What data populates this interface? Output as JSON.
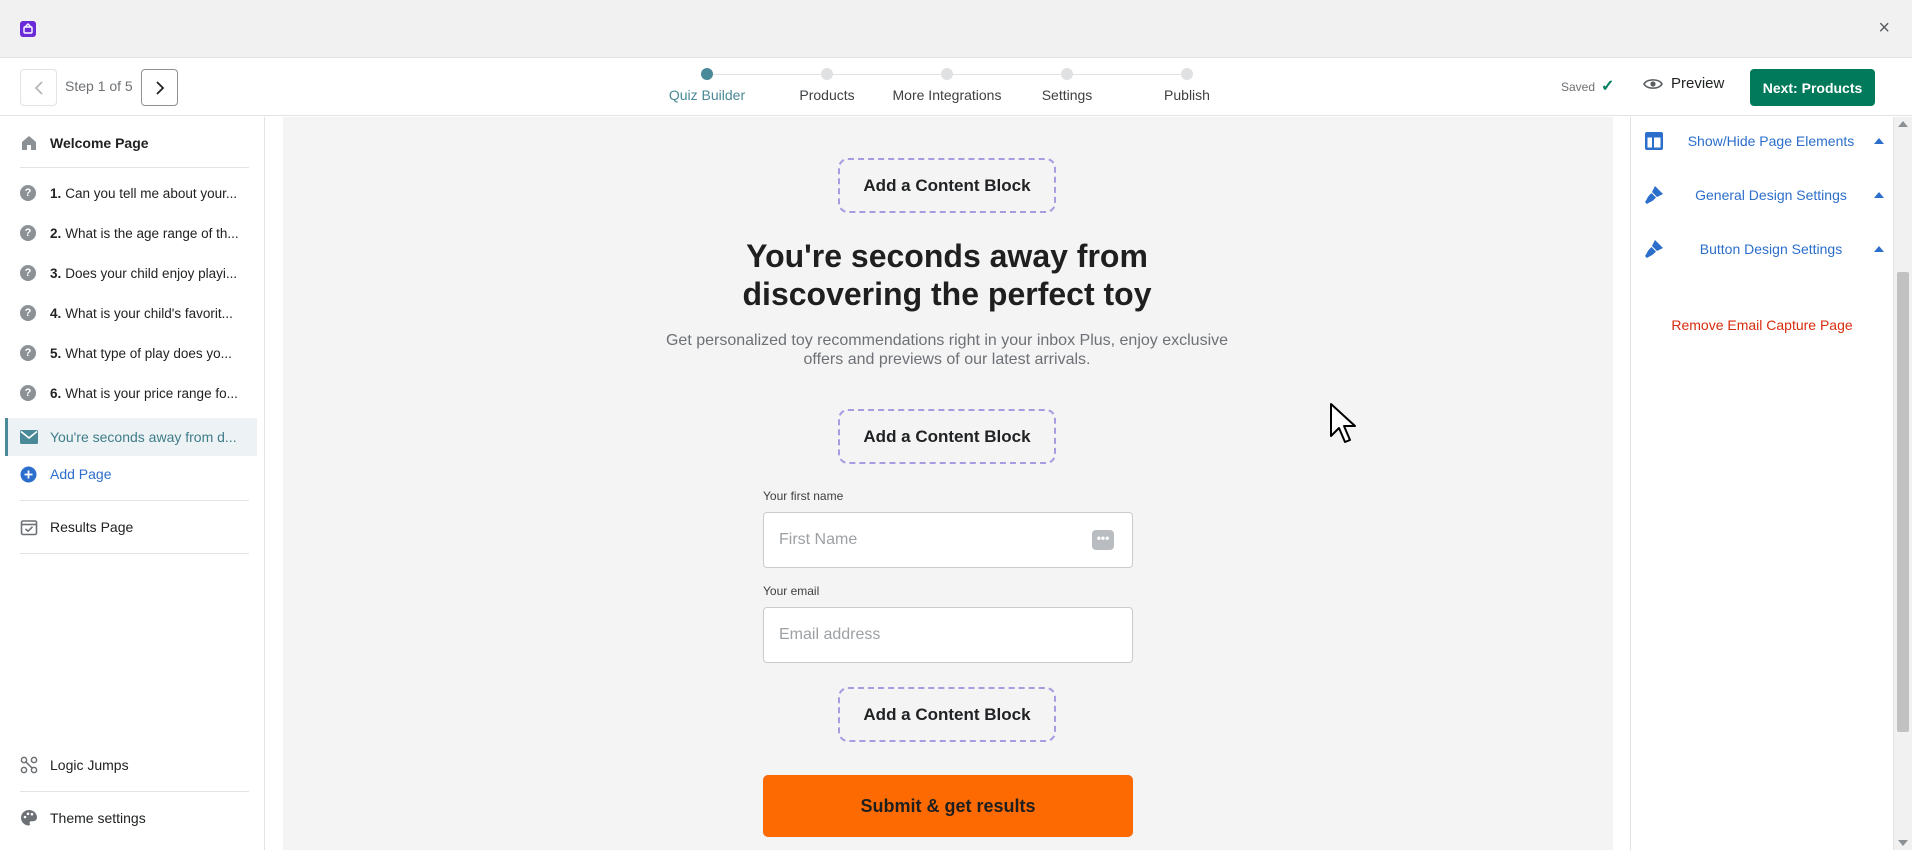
{
  "window": {
    "close_glyph": "×"
  },
  "topbar": {
    "step_count": "Step 1 of 5",
    "steps": [
      {
        "label": "Quiz Builder",
        "active": true
      },
      {
        "label": "Products",
        "active": false
      },
      {
        "label": "More Integrations",
        "active": false
      },
      {
        "label": "Settings",
        "active": false
      },
      {
        "label": "Publish",
        "active": false
      }
    ],
    "saved_label": "Saved",
    "preview_label": "Preview",
    "next_label": "Next: Products",
    "accent_color": "#4a8a98",
    "primary_color": "#007a5a"
  },
  "sidebar": {
    "welcome_label": "Welcome Page",
    "questions": [
      {
        "num": "1.",
        "text": "Can you tell me about your..."
      },
      {
        "num": "2.",
        "text": "What is the age range of th..."
      },
      {
        "num": "3.",
        "text": "Does your child enjoy playi..."
      },
      {
        "num": "4.",
        "text": "What is your child's favorit..."
      },
      {
        "num": "5.",
        "text": "What type of play does yo..."
      },
      {
        "num": "6.",
        "text": "What is your price range fo..."
      }
    ],
    "active_page_label": "You're seconds away from d...",
    "add_page_label": "Add Page",
    "results_label": "Results Page",
    "logic_jumps_label": "Logic Jumps",
    "theme_settings_label": "Theme settings"
  },
  "canvas": {
    "content_block_label": "Add a Content Block",
    "headline": "You're seconds away from discovering the perfect toy",
    "subtext": "Get personalized toy recommendations right in your inbox Plus, enjoy exclusive offers and previews of our latest arrivals.",
    "first_name_label": "Your first name",
    "first_name_placeholder": "First Name",
    "email_label": "Your email",
    "email_placeholder": "Email address",
    "submit_label": "Submit & get results",
    "submit_color": "#fd6a02"
  },
  "right_panel": {
    "items": [
      {
        "label": "Show/Hide Page Elements",
        "icon": "layout-icon"
      },
      {
        "label": "General Design Settings",
        "icon": "paintbrush-icon"
      },
      {
        "label": "Button Design Settings",
        "icon": "paintbrush-icon"
      }
    ],
    "remove_label": "Remove Email Capture Page",
    "remove_color": "#d72c0d",
    "link_color": "#2c6ecb"
  }
}
